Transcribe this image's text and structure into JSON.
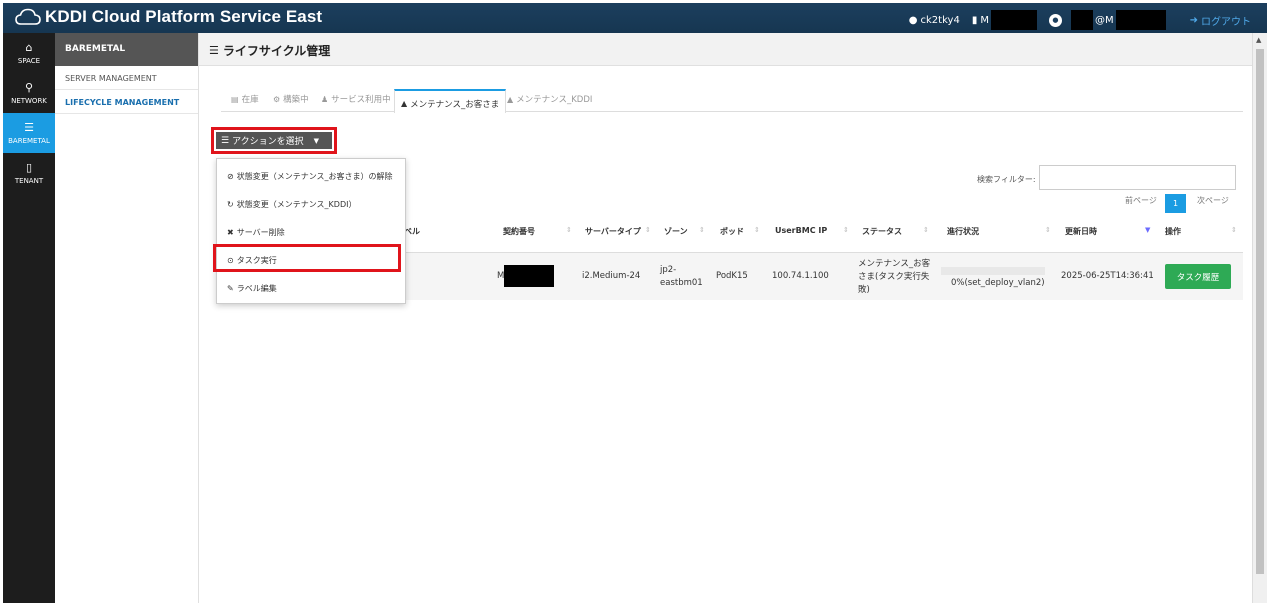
{
  "header": {
    "logo_text": "KDDI Cloud Platform Service East",
    "user_id": "ck2tky4",
    "account_prefix": "M",
    "user_suffix": "@M",
    "logout_label": "ログアウト"
  },
  "leftnav": [
    {
      "label": "SPACE",
      "icon": "home-icon"
    },
    {
      "label": "NETWORK",
      "icon": "sitemap-icon"
    },
    {
      "label": "BAREMETAL",
      "icon": "server-icon"
    },
    {
      "label": "TENANT",
      "icon": "building-icon"
    }
  ],
  "subnav": {
    "title": "BAREMETAL",
    "items": [
      "SERVER MANAGEMENT",
      "LIFECYCLE MANAGEMENT"
    ]
  },
  "page": {
    "title": "ライフサイクル管理"
  },
  "tabs": [
    "在庫",
    "構築中",
    "サービス利用中",
    "メンテナンス_お客さま",
    "メンテナンス_KDDI"
  ],
  "action_button": {
    "label": "アクションを選択"
  },
  "dropdown": [
    "状態変更（メンテナンス_お客さま）の解除",
    "状態変更（メンテナンス_KDDI）",
    "サーバー削除",
    "タスク実行",
    "ラベル編集"
  ],
  "search": {
    "label": "検索フィルター:"
  },
  "pager": {
    "prev": "前ページ",
    "current": "1",
    "next": "次ページ"
  },
  "table": {
    "headers": [
      "ベル",
      "契約番号",
      "サーバータイプ",
      "ゾーン",
      "ポッド",
      "UserBMC IP",
      "ステータス",
      "進行状況",
      "更新日時",
      "操作"
    ],
    "row": {
      "contract_prefix": "M",
      "server_type": "i2.Medium-24",
      "zone_line1": "jp2-",
      "zone_line2": "eastbm01",
      "pod": "PodK15",
      "ip": "100.74.1.100",
      "status_line1": "メンテナンス_お客",
      "status_line2": "さま(タスク実行失",
      "status_line3": "敗)",
      "progress": "0%(set_deploy_vlan2)",
      "progress_value": 0,
      "updated": "2025-06-25T14:36:41",
      "action_label": "タスク履歴"
    }
  },
  "colors": {
    "accent": "#1b9ce2",
    "header_bg": "#1c3f5e",
    "highlight": "#e0141b",
    "success": "#2eaa55"
  }
}
